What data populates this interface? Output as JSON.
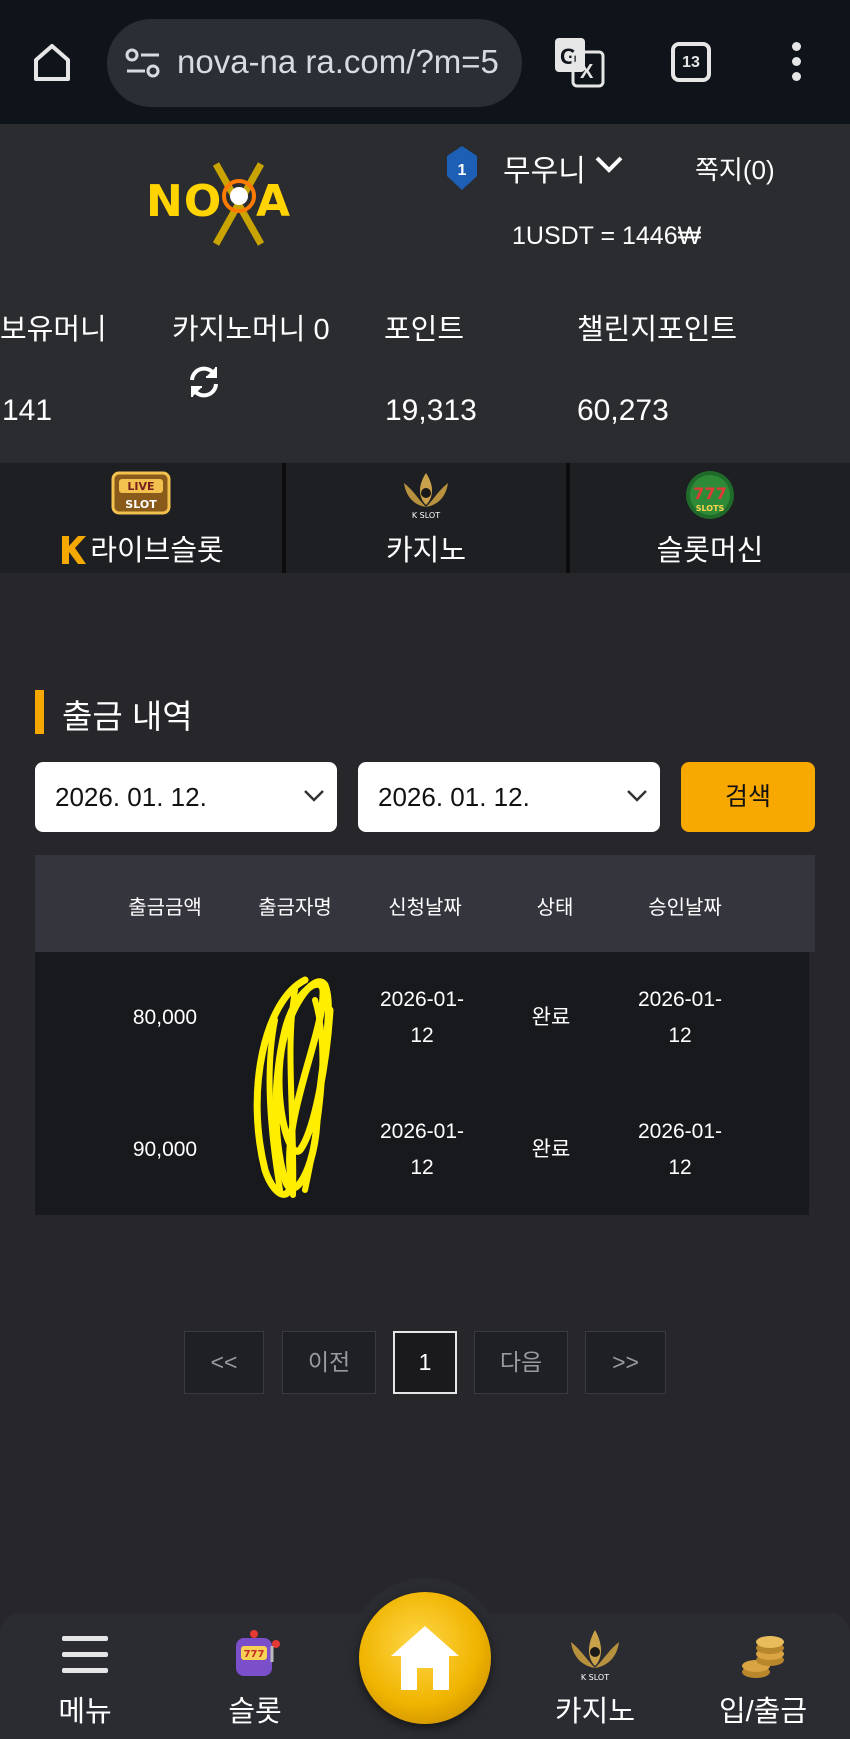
{
  "browser": {
    "url": "nova-na ra.com/?m=5",
    "tab_count": "13"
  },
  "header": {
    "logo_text": "NOVA",
    "level": "1",
    "username": "무우니",
    "messages": "쪽지(0)",
    "rate": "1USDT = 1446₩"
  },
  "balances": {
    "money_label": "보유머니",
    "money_value": "141",
    "casino_label": "카지노머니 0",
    "point_label": "포인트",
    "point_value": "19,313",
    "challenge_label": "챌린지포인트",
    "challenge_value": "60,273"
  },
  "categories": [
    {
      "label": "라이브슬롯",
      "icon": "live-slot-icon"
    },
    {
      "label": "카지노",
      "icon": "k-slot-lotus-icon"
    },
    {
      "label": "슬롯머신",
      "icon": "777-slots-icon"
    }
  ],
  "section": {
    "title": "출금 내역",
    "date_from": "2026. 01. 12.",
    "date_to": "2026. 01. 12.",
    "search_label": "검색"
  },
  "table": {
    "headers": [
      "출금금액",
      "출금자명",
      "신청날짜",
      "상태",
      "승인날짜"
    ],
    "rows": [
      {
        "amount": "80,000",
        "name": "",
        "request_date": "2026-01-12",
        "request_line1": "2026-01-",
        "request_line2": "12",
        "status": "완료",
        "approve_line1": "2026-01-",
        "approve_line2": "12"
      },
      {
        "amount": "90,000",
        "name": "",
        "request_date": "2026-01-12",
        "request_line1": "2026-01-",
        "request_line2": "12",
        "status": "완료",
        "approve_line1": "2026-01-",
        "approve_line2": "12"
      }
    ]
  },
  "pagination": {
    "first": "<<",
    "prev": "이전",
    "current": "1",
    "next": "다음",
    "last": ">>"
  },
  "bottom_nav": [
    {
      "label": "메뉴",
      "icon": "hamburger-icon"
    },
    {
      "label": "슬롯",
      "icon": "slot-machine-icon"
    },
    {
      "label": "",
      "icon": "home-icon"
    },
    {
      "label": "카지노",
      "icon": "casino-lotus-icon"
    },
    {
      "label": "입/출금",
      "icon": "coins-icon"
    }
  ],
  "colors": {
    "accent": "#f7a801",
    "background": "#26262b",
    "header": "#2b2c30"
  }
}
